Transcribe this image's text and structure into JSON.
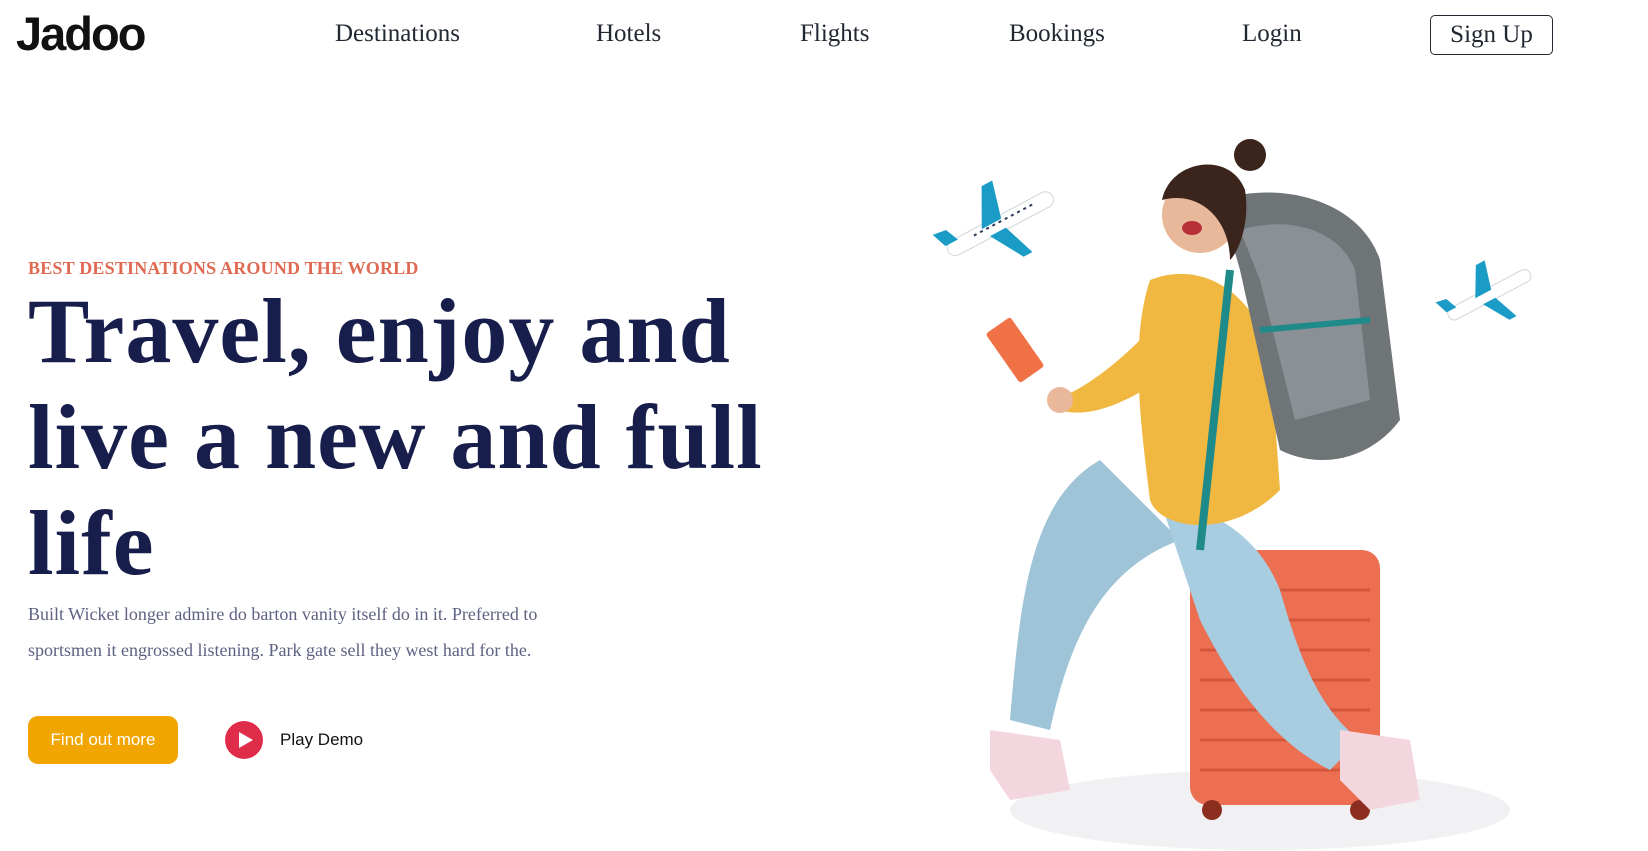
{
  "brand": {
    "logo": "Jadoo"
  },
  "nav": {
    "items": [
      {
        "label": "Destinations"
      },
      {
        "label": "Hotels"
      },
      {
        "label": "Flights"
      },
      {
        "label": "Bookings"
      },
      {
        "label": "Login"
      }
    ],
    "signup_label": "Sign Up"
  },
  "hero": {
    "eyebrow": "BEST DESTINATIONS AROUND THE WORLD",
    "headline": "Travel, enjoy and live a new and full life",
    "description": "Built Wicket longer admire do barton vanity itself do in it. Preferred to sportsmen it engrossed listening. Park gate sell they west hard for the.",
    "cta_label": "Find out more",
    "play_label": "Play Demo",
    "image_alt": "traveler-with-backpack-on-suitcase"
  },
  "colors": {
    "accent_orange": "#df6951",
    "cta_yellow": "#f1a501",
    "heading_navy": "#181e4b",
    "text_gray": "#5e6282",
    "play_red": "#df2c48"
  }
}
